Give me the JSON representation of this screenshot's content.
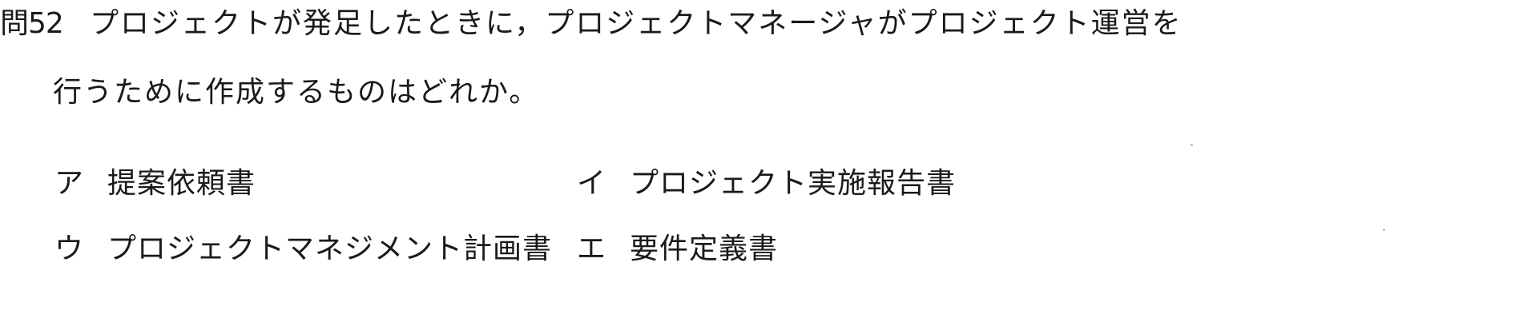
{
  "question": {
    "number": "問52",
    "line1": "プロジェクトが発足したときに，プロジェクトマネージャがプロジェクト運営を",
    "line2": "行うために作成するものはどれか。"
  },
  "choices": [
    {
      "label": "ア",
      "text": "提案依頼書"
    },
    {
      "label": "イ",
      "text": "プロジェクト実施報告書"
    },
    {
      "label": "ウ",
      "text": "プロジェクトマネジメント計画書"
    },
    {
      "label": "エ",
      "text": "要件定義書"
    }
  ]
}
